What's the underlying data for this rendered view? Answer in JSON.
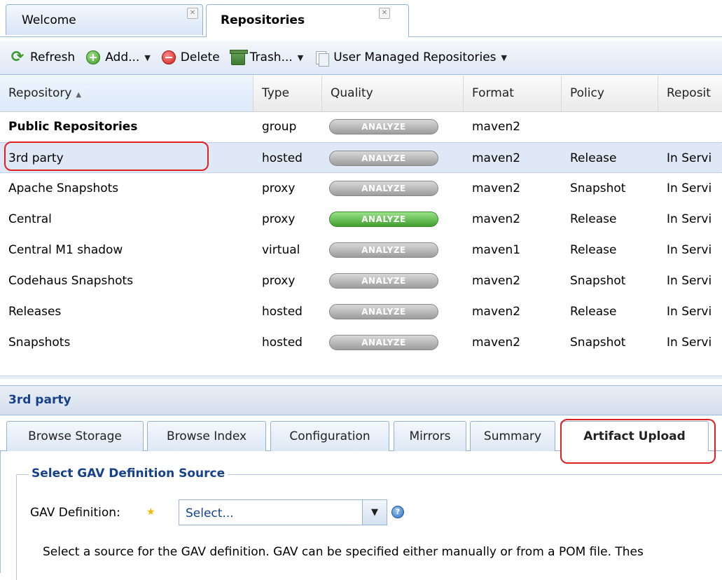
{
  "tabs": [
    {
      "label": "Welcome",
      "close_icon": "close-icon"
    },
    {
      "label": "Repositories",
      "close_icon": "close-icon"
    }
  ],
  "toolbar": {
    "refresh_label": "Refresh",
    "add_label": "Add...",
    "delete_label": "Delete",
    "trash_label": "Trash...",
    "user_managed_label": "User Managed Repositories"
  },
  "grid": {
    "columns": [
      "Repository",
      "Type",
      "Quality",
      "Format",
      "Policy",
      "Reposit"
    ],
    "rows": [
      {
        "repository": "Public Repositories",
        "type": "group",
        "quality": "ANALYZE",
        "quality_status": "gray",
        "format": "maven2",
        "policy": "",
        "status": ""
      },
      {
        "repository": "3rd party",
        "type": "hosted",
        "quality": "ANALYZE",
        "quality_status": "gray",
        "format": "maven2",
        "policy": "Release",
        "status": "In Servi"
      },
      {
        "repository": "Apache Snapshots",
        "type": "proxy",
        "quality": "ANALYZE",
        "quality_status": "gray",
        "format": "maven2",
        "policy": "Snapshot",
        "status": "In Servi"
      },
      {
        "repository": "Central",
        "type": "proxy",
        "quality": "ANALYZE",
        "quality_status": "green",
        "format": "maven2",
        "policy": "Release",
        "status": "In Servi"
      },
      {
        "repository": "Central M1 shadow",
        "type": "virtual",
        "quality": "ANALYZE",
        "quality_status": "gray",
        "format": "maven1",
        "policy": "Release",
        "status": "In Servi"
      },
      {
        "repository": "Codehaus Snapshots",
        "type": "proxy",
        "quality": "ANALYZE",
        "quality_status": "gray",
        "format": "maven2",
        "policy": "Snapshot",
        "status": "In Servi"
      },
      {
        "repository": "Releases",
        "type": "hosted",
        "quality": "ANALYZE",
        "quality_status": "gray",
        "format": "maven2",
        "policy": "Release",
        "status": "In Servi"
      },
      {
        "repository": "Snapshots",
        "type": "hosted",
        "quality": "ANALYZE",
        "quality_status": "gray",
        "format": "maven2",
        "policy": "Snapshot",
        "status": "In Servi"
      }
    ]
  },
  "detail": {
    "title": "3rd party",
    "tabs": [
      "Browse Storage",
      "Browse Index",
      "Configuration",
      "Mirrors",
      "Summary",
      "Artifact Upload"
    ],
    "active_tab": "Artifact Upload",
    "fieldset_legend": "Select GAV Definition Source",
    "gav_label": "GAV Definition:",
    "select_value": "Select...",
    "description": "Select a source for the GAV definition. GAV can be specified either manually or from a POM file. Thes"
  },
  "colors": {
    "accent": "#15428b",
    "annotation_red": "#e02020",
    "analyze_green": "#3f9f2c"
  }
}
